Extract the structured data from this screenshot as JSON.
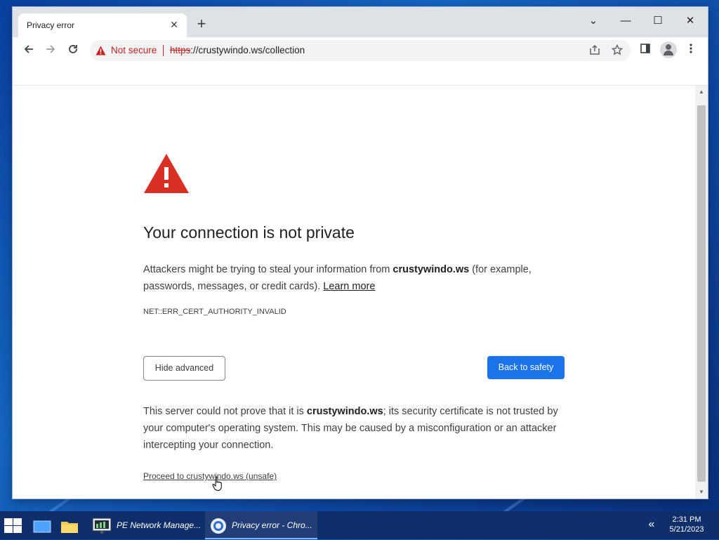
{
  "browser": {
    "tab_title": "Privacy error",
    "close_tab_symbol": "✕",
    "new_tab_symbol": "+",
    "window_controls": {
      "menu": "⌄",
      "minimize": "—",
      "maximize": "☐",
      "close": "✕"
    },
    "security_label": "Not secure",
    "url_scheme": "https",
    "url_rest": "://crustywindo.ws/collection",
    "icons": [
      "back-icon",
      "forward-icon",
      "reload-icon",
      "share-icon",
      "star-icon",
      "side-panel-icon",
      "profile-icon",
      "menu-icon"
    ]
  },
  "page": {
    "heading": "Your connection is not private",
    "desc_before": "Attackers might be trying to steal your information from ",
    "desc_host": "crustywindo.ws",
    "desc_after": " (for example, passwords, messages, or credit cards). ",
    "learn_more": "Learn more",
    "error_code": "NET::ERR_CERT_AUTHORITY_INVALID",
    "hide_advanced": "Hide advanced",
    "back_to_safety": "Back to safety",
    "detail_before": "This server could not prove that it is ",
    "detail_host": "crustywindo.ws",
    "detail_after": "; its security certificate is not trusted by your computer's operating system. This may be caused by a misconfiguration or an attacker intercepting your connection.",
    "proceed_link": "Proceed to crustywindo.ws (unsafe)"
  },
  "taskbar": {
    "items": [
      {
        "label": "PE Network Manage..."
      },
      {
        "label": "Privacy error - Chro..."
      }
    ],
    "time": "2:31 PM",
    "date": "5/21/2023"
  },
  "colors": {
    "warning_red": "#d93025",
    "primary_blue": "#1a73e8",
    "desktop_blue": "#0d47a1"
  }
}
